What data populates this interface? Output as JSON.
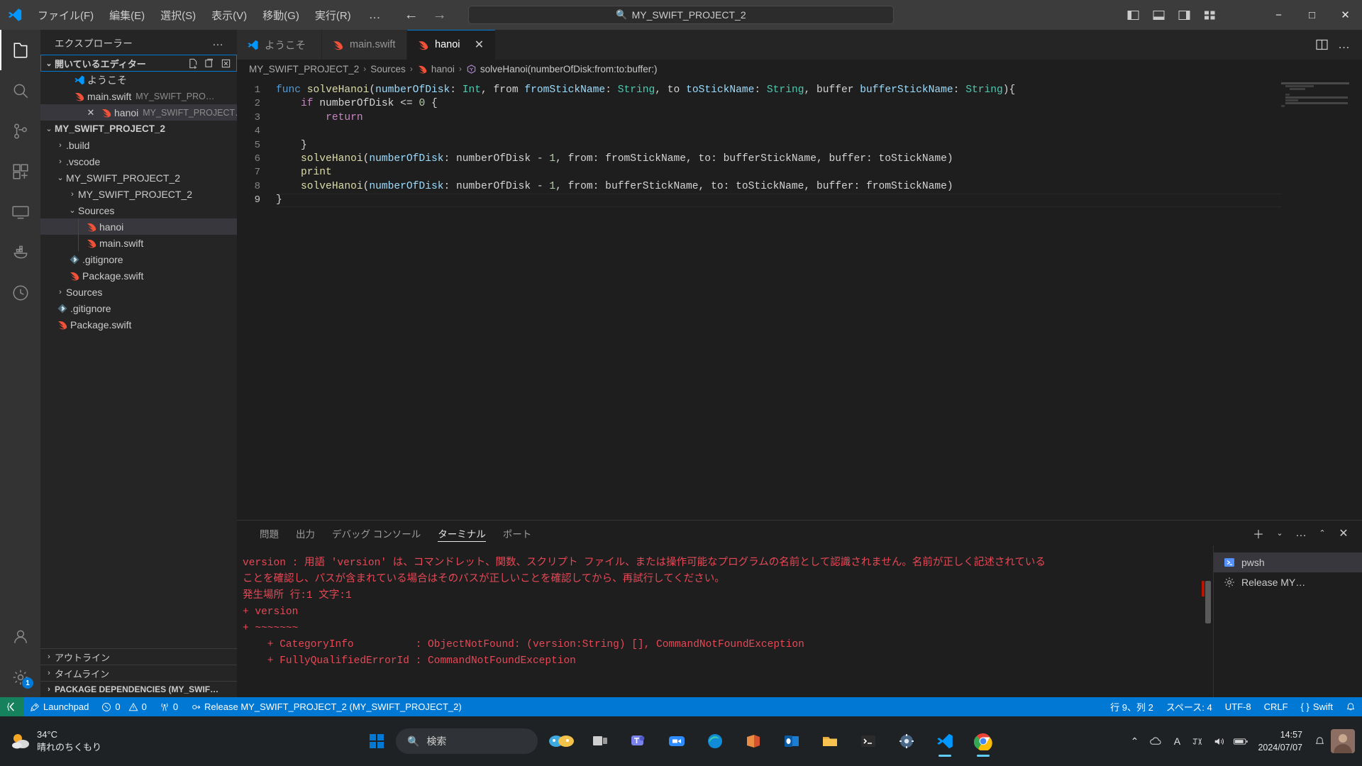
{
  "titlebar": {
    "menu": [
      "ファイル(F)",
      "編集(E)",
      "選択(S)",
      "表示(V)",
      "移動(G)",
      "実行(R)"
    ],
    "menu_overflow": "…",
    "command_center_text": "MY_SWIFT_PROJECT_2",
    "search_icon": "search-icon",
    "back_arrow": "←",
    "forward_arrow": "→",
    "minimize": "−",
    "maximize": "□",
    "close": "✕"
  },
  "activitybar": {
    "items": [
      {
        "name": "explorer",
        "icon": "files-icon"
      },
      {
        "name": "search",
        "icon": "search-icon"
      },
      {
        "name": "source-control",
        "icon": "source-control-icon"
      },
      {
        "name": "extensions",
        "icon": "extensions-icon"
      },
      {
        "name": "remote-explorer",
        "icon": "remote-explorer-icon"
      },
      {
        "name": "docker",
        "icon": "docker-icon"
      },
      {
        "name": "testing",
        "icon": "beaker-icon"
      }
    ],
    "bottom": [
      {
        "name": "accounts",
        "icon": "account-icon",
        "badge": ""
      },
      {
        "name": "settings",
        "icon": "gear-icon",
        "badge": "1"
      }
    ]
  },
  "sidebar": {
    "title": "エクスプローラー",
    "title_dots": "…",
    "open_editors": {
      "label": "開いているエディター",
      "chevron": "⌄",
      "actions": [
        "new-file-icon",
        "new-folder-icon",
        "close-all-editors-icon"
      ],
      "items": [
        {
          "label": "ようこそ",
          "desc": "",
          "icon": "vscode-icon",
          "close": "",
          "selected": false
        },
        {
          "label": "main.swift",
          "desc": "MY_SWIFT_PRO…",
          "icon": "swift-icon",
          "close": "",
          "selected": false
        },
        {
          "label": "hanoi",
          "desc": "MY_SWIFT_PROJECT…",
          "icon": "swift-icon",
          "close": "✕",
          "selected": true
        }
      ]
    },
    "workspace": {
      "label": "MY_SWIFT_PROJECT_2",
      "chevron": "⌄",
      "tree": [
        {
          "label": ".build",
          "icon": "",
          "chevron": "›",
          "indent": 1,
          "selected": false
        },
        {
          "label": ".vscode",
          "icon": "",
          "chevron": "›",
          "indent": 1,
          "selected": false
        },
        {
          "label": "MY_SWIFT_PROJECT_2",
          "icon": "",
          "chevron": "⌄",
          "indent": 1,
          "selected": false
        },
        {
          "label": "MY_SWIFT_PROJECT_2",
          "icon": "",
          "chevron": "›",
          "indent": 2,
          "selected": false
        },
        {
          "label": "Sources",
          "icon": "",
          "chevron": "⌄",
          "indent": 2,
          "selected": false
        },
        {
          "label": "hanoi",
          "icon": "swift-icon",
          "chevron": "",
          "indent": 3,
          "selected": true
        },
        {
          "label": "main.swift",
          "icon": "swift-icon",
          "chevron": "",
          "indent": 3,
          "selected": false
        },
        {
          "label": ".gitignore",
          "icon": "git-icon",
          "chevron": "",
          "indent": 2,
          "selected": false
        },
        {
          "label": "Package.swift",
          "icon": "swift-icon",
          "chevron": "",
          "indent": 2,
          "selected": false
        },
        {
          "label": "Sources",
          "icon": "",
          "chevron": "›",
          "indent": 1,
          "selected": false
        },
        {
          "label": ".gitignore",
          "icon": "git-icon",
          "chevron": "",
          "indent": 1,
          "selected": false
        },
        {
          "label": "Package.swift",
          "icon": "swift-icon",
          "chevron": "",
          "indent": 1,
          "selected": false
        }
      ]
    },
    "collapsed_sections": [
      {
        "label": "アウトライン",
        "chevron": "›",
        "bold": false
      },
      {
        "label": "タイムライン",
        "chevron": "›",
        "bold": false
      },
      {
        "label": "PACKAGE DEPENDENCIES (MY_SWIF…",
        "chevron": "›",
        "bold": true
      }
    ]
  },
  "editor": {
    "tabs": [
      {
        "label": "ようこそ",
        "icon": "vscode-icon",
        "active": false,
        "close": ""
      },
      {
        "label": "main.swift",
        "icon": "swift-icon",
        "active": false,
        "close": ""
      },
      {
        "label": "hanoi",
        "icon": "swift-icon",
        "active": true,
        "close": "✕"
      }
    ],
    "tab_actions": [
      "split-editor-icon",
      "more-actions-dots"
    ],
    "breadcrumb": [
      {
        "label": "MY_SWIFT_PROJECT_2",
        "icon": ""
      },
      {
        "label": "Sources",
        "icon": ""
      },
      {
        "label": "hanoi",
        "icon": "swift-icon"
      },
      {
        "label": "solveHanoi(numberOfDisk:from:to:buffer:)",
        "icon": "symbol-method-icon"
      }
    ],
    "breadcrumb_separator": "›",
    "line_numbers": [
      "1",
      "2",
      "3",
      "4",
      "5",
      "6",
      "7",
      "8",
      "9"
    ],
    "current_line": 9,
    "code": [
      [
        {
          "t": "func ",
          "c": "kw"
        },
        {
          "t": "solveHanoi",
          "c": "fn"
        },
        {
          "t": "(",
          "c": "op"
        },
        {
          "t": "numberOfDisk",
          "c": "pl"
        },
        {
          "t": ": ",
          "c": "op"
        },
        {
          "t": "Int",
          "c": "type"
        },
        {
          "t": ", from ",
          "c": "op"
        },
        {
          "t": "fromStickName",
          "c": "pl"
        },
        {
          "t": ": ",
          "c": "op"
        },
        {
          "t": "String",
          "c": "type"
        },
        {
          "t": ", to ",
          "c": "op"
        },
        {
          "t": "toStickName",
          "c": "pl"
        },
        {
          "t": ": ",
          "c": "op"
        },
        {
          "t": "String",
          "c": "type"
        },
        {
          "t": ", buffer ",
          "c": "op"
        },
        {
          "t": "bufferStickName",
          "c": "pl"
        },
        {
          "t": ": ",
          "c": "op"
        },
        {
          "t": "String",
          "c": "type"
        },
        {
          "t": "){",
          "c": "op"
        }
      ],
      [
        {
          "t": "    ",
          "c": "op"
        },
        {
          "t": "if ",
          "c": "kw2"
        },
        {
          "t": "numberOfDisk ",
          "c": "op"
        },
        {
          "t": "<= ",
          "c": "op"
        },
        {
          "t": "0",
          "c": "num"
        },
        {
          "t": " {",
          "c": "op"
        }
      ],
      [
        {
          "t": "        ",
          "c": "op"
        },
        {
          "t": "return",
          "c": "kw2"
        }
      ],
      [
        {
          "t": "",
          "c": "op"
        }
      ],
      [
        {
          "t": "    }",
          "c": "op"
        }
      ],
      [
        {
          "t": "    ",
          "c": "op"
        },
        {
          "t": "solveHanoi",
          "c": "fn"
        },
        {
          "t": "(",
          "c": "op"
        },
        {
          "t": "numberOfDisk",
          "c": "pl"
        },
        {
          "t": ": numberOfDisk ",
          "c": "op"
        },
        {
          "t": "- ",
          "c": "op"
        },
        {
          "t": "1",
          "c": "num"
        },
        {
          "t": ", from: fromStickName, to: bufferStickName, buffer: toStickName)",
          "c": "op"
        }
      ],
      [
        {
          "t": "    ",
          "c": "op"
        },
        {
          "t": "print",
          "c": "fn"
        }
      ],
      [
        {
          "t": "    ",
          "c": "op"
        },
        {
          "t": "solveHanoi",
          "c": "fn"
        },
        {
          "t": "(",
          "c": "op"
        },
        {
          "t": "numberOfDisk",
          "c": "pl"
        },
        {
          "t": ": numberOfDisk ",
          "c": "op"
        },
        {
          "t": "- ",
          "c": "op"
        },
        {
          "t": "1",
          "c": "num"
        },
        {
          "t": ", from: bufferStickName, to: toStickName, buffer: fromStickName)",
          "c": "op"
        }
      ],
      [
        {
          "t": "}",
          "c": "op"
        }
      ]
    ]
  },
  "panel": {
    "tabs": [
      "問題",
      "出力",
      "デバッグ コンソール",
      "ターミナル",
      "ポート"
    ],
    "active_tab": "ターミナル",
    "actions": [
      "add-terminal-plus",
      "terminal-dropdown-chevron",
      "more-actions-dots",
      "maximize-panel-chevron",
      "close-panel-x"
    ],
    "terminal_output": [
      "version : 用語 'version' は、コマンドレット、関数、スクリプト ファイル、または操作可能なプログラムの名前として認識されません。名前が正しく記述されている",
      "ことを確認し、パスが含まれている場合はそのパスが正しいことを確認してから、再試行してください。",
      "発生場所 行:1 文字:1",
      "+ version",
      "+ ~~~~~~~",
      "    + CategoryInfo          : ObjectNotFound: (version:String) [], CommandNotFoundException",
      "    + FullyQualifiedErrorId : CommandNotFoundException"
    ],
    "terminal_list": [
      {
        "label": "pwsh",
        "icon": "terminal-powershell-icon",
        "selected": true
      },
      {
        "label": "Release MY…",
        "icon": "gear-task-icon",
        "selected": false
      }
    ]
  },
  "statusbar": {
    "remote_icon": "remote-indicator-icon",
    "launchpad": "Launchpad",
    "launchpad_icon": "rocket-icon",
    "errors": "0",
    "warnings": "0",
    "error_icon": "error-circle-icon",
    "warning_icon": "warning-triangle-icon",
    "radio_tower_icon": "radio-tower-icon",
    "radio_count": "0",
    "build_target_icon": "target-icon",
    "build_target": "Release MY_SWIFT_PROJECT_2 (MY_SWIFT_PROJECT_2)",
    "cursor_position": "行 9、列 2",
    "indentation": "スペース: 4",
    "encoding": "UTF-8",
    "eol": "CRLF",
    "language_icon": "braces-icon",
    "language": "Swift",
    "bell_icon": "bell-icon"
  },
  "taskbar": {
    "weather_temp": "34°C",
    "weather_desc": "晴れのちくもり",
    "weather_icon": "sun-cloud-icon",
    "start_icon": "windows-logo",
    "search_placeholder": "検索",
    "search_icon": "search-icon",
    "apps": [
      {
        "name": "copilot-widget",
        "icon": "taskview-widget-icon"
      },
      {
        "name": "task-view",
        "icon": "task-view-icon"
      },
      {
        "name": "teams",
        "icon": "teams-icon"
      },
      {
        "name": "zoom",
        "icon": "zoom-icon"
      },
      {
        "name": "edge",
        "icon": "edge-icon"
      },
      {
        "name": "office",
        "icon": "office-icon"
      },
      {
        "name": "outlook",
        "icon": "outlook-icon"
      },
      {
        "name": "file-explorer",
        "icon": "folder-icon"
      },
      {
        "name": "terminal",
        "icon": "terminal-icon"
      },
      {
        "name": "settings",
        "icon": "settings-icon"
      },
      {
        "name": "vscode",
        "icon": "vscode-icon",
        "active": true
      },
      {
        "name": "chrome",
        "icon": "chrome-icon",
        "active": true
      }
    ],
    "tray": [
      "chevron-up-icon",
      "cloud-icon",
      "ime-a-icon",
      "ime-mode-icon",
      "volume-icon",
      "battery-icon"
    ],
    "clock_time": "14:57",
    "clock_date": "2024/07/07",
    "notification_icon": "bell-icon"
  }
}
